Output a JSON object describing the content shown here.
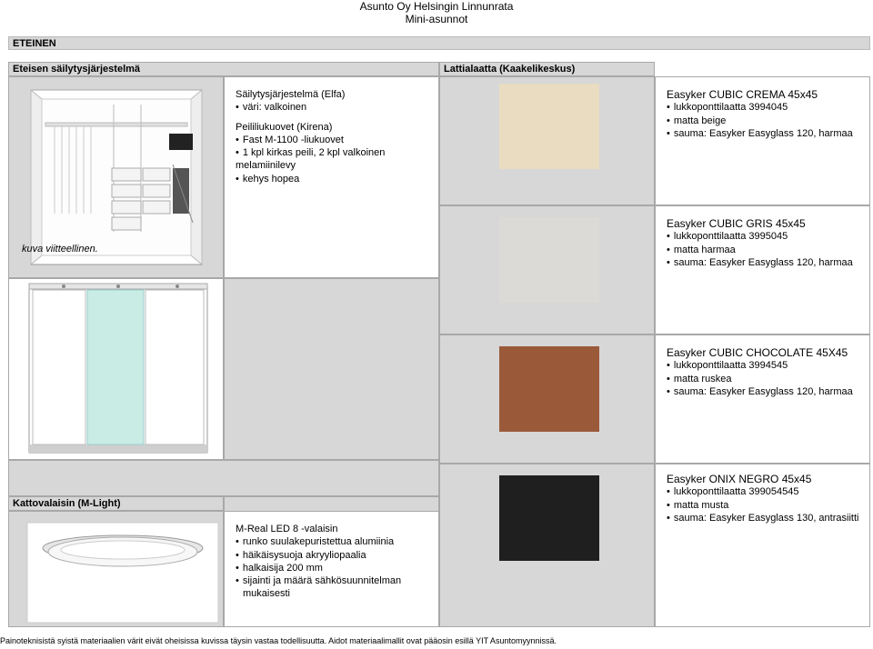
{
  "header": {
    "line1": "Asunto Oy Helsingin Linnunrata",
    "line2": "Mini-asunnot"
  },
  "section_title": "ETEINEN",
  "storage": {
    "panel_title": "Eteisen säilytysjärjestelmä",
    "caption": "kuva viitteellinen.",
    "system_title": "Säilytysjärjestelmä (Elfa)",
    "system_items": [
      "väri: valkoinen"
    ],
    "doors_title": "Peililiukuovet (Kirena)",
    "doors_items": [
      "Fast M-1100 -liukuovet",
      "1 kpl kirkas peili, 2 kpl valkoinen melamiinilevy",
      "kehys hopea"
    ]
  },
  "tiles": {
    "panel_title": "Lattialaatta (Kaakelikeskus)",
    "items": [
      {
        "name": "Easyker CUBIC CREMA 45x45",
        "details": [
          "lukkoponttilaatta 3994045",
          "matta beige",
          "sauma: Easyker Easyglass 120, harmaa"
        ],
        "color": "#e9dcc1"
      },
      {
        "name": "Easyker CUBIC GRIS 45x45",
        "details": [
          "lukkoponttilaatta 3995045",
          "matta harmaa",
          "sauma: Easyker Easyglass 120, harmaa"
        ],
        "color": "#dcdad6"
      },
      {
        "name": "Easyker CUBIC CHOCOLATE 45X45",
        "details": [
          "lukkoponttilaatta 3994545",
          "matta ruskea",
          "sauma: Easyker Easyglass 120, harmaa"
        ],
        "color": "#9a5a3a"
      },
      {
        "name": "Easyker ONIX NEGRO 45x45",
        "details": [
          "lukkoponttilaatta 399054545",
          "matta musta",
          "sauma: Easyker Easyglass 130, antrasiitti"
        ],
        "color": "#1f1f1f"
      }
    ]
  },
  "lighting": {
    "panel_title": "Kattovalaisin (M-Light)",
    "product_title": "M-Real LED 8 -valaisin",
    "items": [
      "runko suulakepuristettua alumiinia",
      "häikäisysuoja akryyliopaalia",
      "halkaisija 200 mm",
      "sijainti ja määrä sähkösuunnitelman"
    ],
    "continuation": "mukaisesti"
  },
  "footer": "Painoteknisistä syistä materiaalien värit eivät oheisissa kuvissa täysin vastaa todellisuutta. Aidot materiaalimallit ovat pääosin esillä YIT Asuntomyynnissä."
}
